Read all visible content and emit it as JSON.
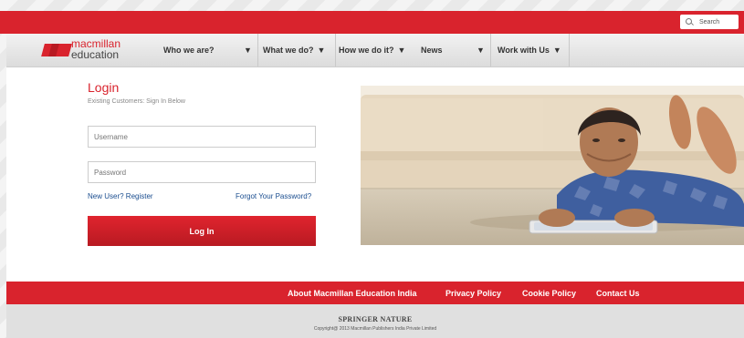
{
  "search": {
    "placeholder": "Search"
  },
  "logo": {
    "line1": "macmillan",
    "line2": "education"
  },
  "nav": {
    "items": [
      {
        "label": "Who we are?",
        "arrow": "▼"
      },
      {
        "label": "What we do?",
        "arrow": "▼"
      },
      {
        "label": "How we do it?",
        "arrow": "▼"
      },
      {
        "label": "News",
        "arrow": "▼"
      },
      {
        "label": "Work with Us",
        "arrow": "▼"
      }
    ]
  },
  "login": {
    "title": "Login",
    "subtitle": "Existing Customers: Sign In Below",
    "username_placeholder": "Username",
    "password_placeholder": "Password",
    "register_link": "New User? Register",
    "forgot_link": "Forgot Your Password?",
    "button": "Log In"
  },
  "footer": {
    "links": [
      "About Macmillan Education India",
      "Privacy Policy",
      "Cookie Policy",
      "Contact Us"
    ],
    "brand": "SPRINGER NATURE",
    "copyright": "Copyright@ 2013 Macmillan Publishers India Private Limited"
  },
  "colors": {
    "brand_red": "#d9232d",
    "link_blue": "#1a4d8f"
  },
  "icons": {
    "search": "magnifier-icon",
    "dropdown": "triangle-down-icon"
  }
}
